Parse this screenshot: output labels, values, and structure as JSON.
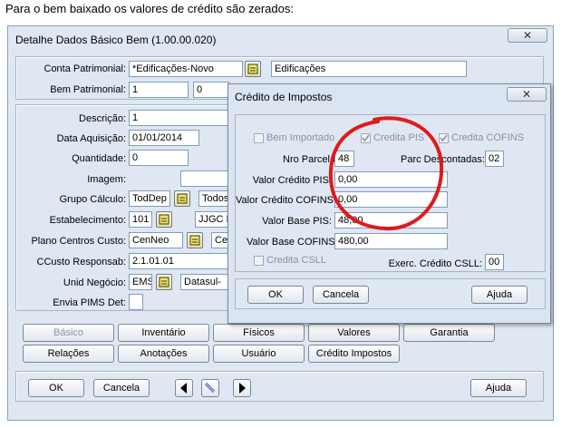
{
  "caption": "Para o bem baixado os valores de crédito são zerados:",
  "main_window": {
    "title": "Detalhe Dados Básico Bem (1.00.00.020)",
    "close_glyph": "✕",
    "conta_label": "Conta Patrimonial:",
    "conta_value": "*Edificações-Novo",
    "conta_desc": "Edificações",
    "bem_label": "Bem Patrimonial:",
    "bem_value": "1",
    "bem_inc": "0",
    "descricao_label": "Descrição:",
    "descricao_value": "1",
    "data_label": "Data Aquisição:",
    "data_value": "01/01/2014",
    "quantidade_label": "Quantidade:",
    "quantidade_value": "0",
    "imagem_label": "Imagem:",
    "grupo_label": "Grupo Cálculo:",
    "grupo_value": "TodDep",
    "grupo_desc": "Todos",
    "estab_label": "Estabelecimento:",
    "estab_value": "101",
    "estab_desc": "JJGC I",
    "plano_label": "Plano Centros Custo:",
    "plano_value": "CenNeo",
    "plano_desc": "Ce",
    "ccusto_label": "CCusto Responsab:",
    "ccusto_value": "2.1.01.01",
    "unid_label": "Unid Negócio:",
    "unid_value": "EMS",
    "unid_desc": "Datasul-",
    "envia_label": "Envia PIMS Det:",
    "tabs_row1": [
      "Básico",
      "Inventário",
      "Físicos",
      "Valores",
      "Garantia"
    ],
    "tabs_row2": [
      "Relações",
      "Anotações",
      "Usuário",
      "Crédito Impostos"
    ],
    "ok_label": "OK",
    "cancel_label": "Cancela",
    "help_label": "Ajuda"
  },
  "dialog": {
    "title": "Crédito de Impostos",
    "close_glyph": "✕",
    "bem_importado_label": "Bem Importado",
    "credita_pis_label": "Credita PIS",
    "credita_cofins_label": "Credita COFINS",
    "nro_parcelas_label": "Nro Parcelas:",
    "nro_parcelas_value": "48",
    "parc_descontadas_label": "Parc Descontadas:",
    "parc_descontadas_value": "02",
    "valor_credito_pis_label": "Valor Crédito PIS:",
    "valor_credito_pis_value": "0,00",
    "valor_credito_cofins_label": "Valor Crédito COFINS:",
    "valor_credito_cofins_value": "0,00",
    "valor_base_pis_label": "Valor Base PIS:",
    "valor_base_pis_value": "48,00",
    "valor_base_cofins_label": "Valor Base COFINS:",
    "valor_base_cofins_value": "480,00",
    "credita_csll_label": "Credita CSLL",
    "exerc_csll_label": "Exerc. Crédito CSLL:",
    "exerc_csll_value": "00",
    "ok_label": "OK",
    "cancel_label": "Cancela",
    "help_label": "Ajuda"
  },
  "colors": {
    "window_bg": "#dfe7f2",
    "highlight_circle": "#e0191b",
    "zoom_icon": "#f5e85a"
  },
  "icons": [
    "zoom-icon",
    "prev-arrow-icon",
    "next-arrow-icon",
    "edit-icon",
    "close-icon",
    "checkbox-checked-icon"
  ]
}
